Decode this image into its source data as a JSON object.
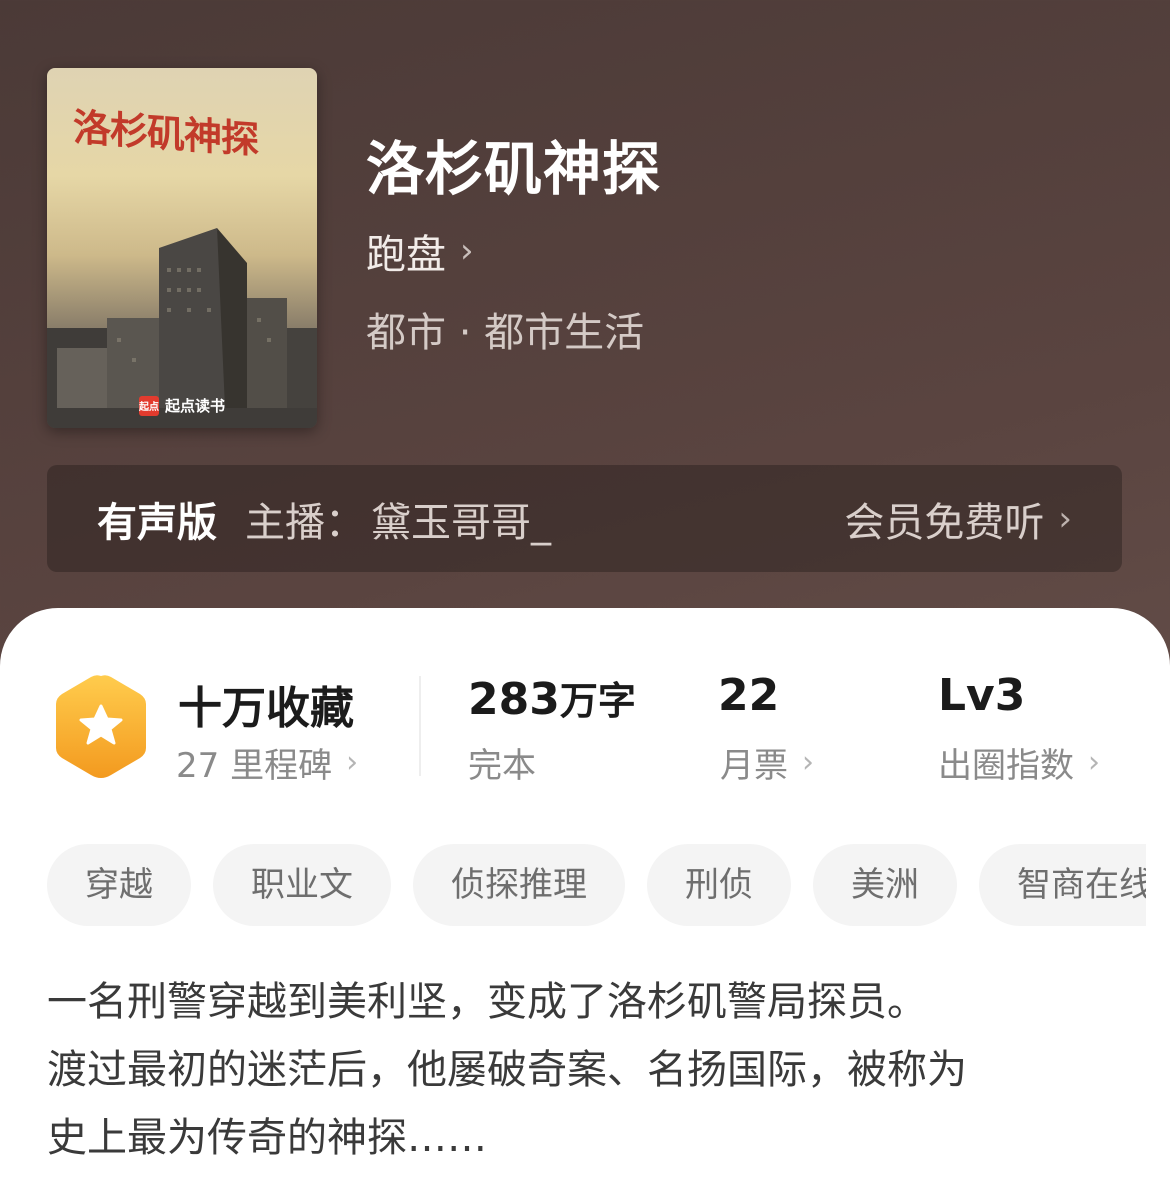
{
  "book": {
    "title": "洛杉矶神探",
    "author": "跑盘",
    "category": "都市 · 都市生活",
    "cover": {
      "title": "洛杉矶神探",
      "brand": "起点读书",
      "brand_mark": "起点"
    }
  },
  "audio": {
    "label": "有声版",
    "host_prefix": "主播：",
    "host_name": "黛玉哥哥_",
    "cta": "会员免费听"
  },
  "stats": {
    "favorites": "十万收藏",
    "milestones": "27 里程碑",
    "word_count_number": "283",
    "word_count_unit": "万字",
    "status": "完本",
    "monthly_tickets": "22",
    "monthly_tickets_label": "月票",
    "level": "Lv3",
    "level_label": "出圈指数"
  },
  "tags": [
    "穿越",
    "职业文",
    "侦探推理",
    "刑侦",
    "美洲",
    "智商在线"
  ],
  "synopsis": [
    "一名刑警穿越到美利坚，变成了洛杉矶警局探员。",
    "渡过最初的迷茫后，他屡破奇案、名扬国际，被称为",
    "史上最为传奇的神探……"
  ],
  "icons": {
    "badge": "star-hexagon-icon",
    "chevron": "chevron-right-icon"
  },
  "colors": {
    "header_bg": "#4b3a37",
    "badge_orange": "#f5a623",
    "tag_bg": "#f4f4f4",
    "cover_title_red": "#c23a2a"
  }
}
